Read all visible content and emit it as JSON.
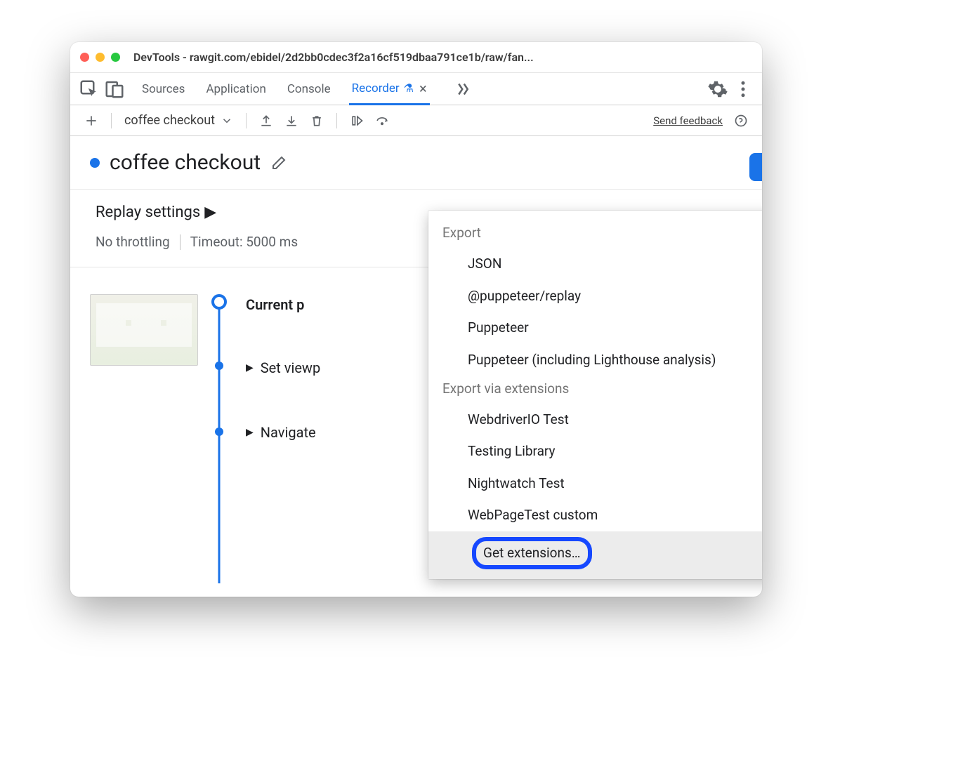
{
  "window": {
    "title": "DevTools - rawgit.com/ebidel/2d2bb0cdec3f2a16cf519dbaa791ce1b/raw/fan..."
  },
  "tabs": {
    "items": [
      "Sources",
      "Application",
      "Console",
      "Recorder"
    ],
    "active_index": 3
  },
  "toolbar": {
    "recording_name": "coffee checkout",
    "feedback": "Send feedback"
  },
  "recording": {
    "title": "coffee checkout"
  },
  "replay": {
    "title": "Replay settings",
    "throttling": "No throttling",
    "timeout": "Timeout: 5000 ms"
  },
  "steps": {
    "current_label": "Current p",
    "items": [
      "Set viewp",
      "Navigate"
    ]
  },
  "popup": {
    "section1": "Export",
    "export_items": [
      "JSON",
      "@puppeteer/replay",
      "Puppeteer",
      "Puppeteer (including Lighthouse analysis)"
    ],
    "section2": "Export via extensions",
    "ext_items": [
      "WebdriverIO Test",
      "Testing Library",
      "Nightwatch Test",
      "WebPageTest custom"
    ],
    "get_extensions": "Get extensions…"
  }
}
